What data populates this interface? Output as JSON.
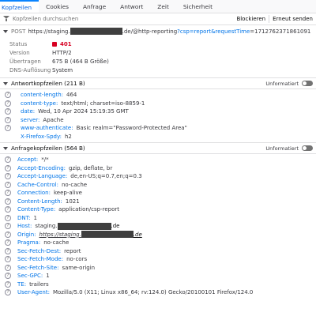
{
  "tabs": [
    {
      "label": "Kopfzeilen",
      "active": true
    },
    {
      "label": "Cookies"
    },
    {
      "label": "Anfrage"
    },
    {
      "label": "Antwort"
    },
    {
      "label": "Zeit"
    },
    {
      "label": "Sicherheit"
    }
  ],
  "filter": {
    "placeholder": "Kopfzeilen durchsuchen",
    "block_label": "Blockieren",
    "resend_label": "Erneut senden"
  },
  "request": {
    "method": "POST",
    "url_prefix": "https://staging.",
    "url_mid": ".de/@http-reporting",
    "url_path": "?csp=report",
    "url_query_key": "&requestTime",
    "url_query_val": "=1712762371861091"
  },
  "summary": [
    {
      "key": "Status",
      "value": "401",
      "status_color": "#d70022"
    },
    {
      "key": "Version",
      "value": "HTTP/2"
    },
    {
      "key": "Übertragen",
      "value": "675 B (464 B Größe)"
    },
    {
      "key": "DNS-Auflösung",
      "value": "System"
    }
  ],
  "response_section": {
    "title": "Antwortkopfzeilen (211 B)",
    "raw_label": "Unformatiert",
    "headers": [
      {
        "key": "content-length",
        "value": "464"
      },
      {
        "key": "content-type",
        "value": "text/html; charset=iso-8859-1"
      },
      {
        "key": "date",
        "value": "Wed, 10 Apr 2024 15:19:35 GMT"
      },
      {
        "key": "server",
        "value": "Apache"
      },
      {
        "key": "www-authenticate",
        "value": "Basic realm=\"Password-Protected Area\""
      },
      {
        "key": "X-Firefox-Spdy",
        "value": "h2"
      }
    ]
  },
  "request_section": {
    "title": "Anfragekopfzeilen (564 B)",
    "raw_label": "Unformatiert",
    "headers": [
      {
        "key": "Accept",
        "value": "*/*"
      },
      {
        "key": "Accept-Encoding",
        "value": "gzip, deflate, br"
      },
      {
        "key": "Accept-Language",
        "value": "de,en-US;q=0.7,en;q=0.3"
      },
      {
        "key": "Cache-Control",
        "value": "no-cache"
      },
      {
        "key": "Connection",
        "value": "keep-alive"
      },
      {
        "key": "Content-Length",
        "value": "1021"
      },
      {
        "key": "Content-Type",
        "value": "application/csp-report"
      },
      {
        "key": "DNT",
        "value": "1"
      },
      {
        "key": "Host",
        "value": "staging.",
        "suffix": ".de"
      },
      {
        "key": "Origin",
        "value": "https://staging.",
        "suffix": ".de"
      },
      {
        "key": "Pragma",
        "value": "no-cache"
      },
      {
        "key": "Sec-Fetch-Dest",
        "value": "report"
      },
      {
        "key": "Sec-Fetch-Mode",
        "value": "no-cors"
      },
      {
        "key": "Sec-Fetch-Site",
        "value": "same-origin"
      },
      {
        "key": "Sec-GPC",
        "value": "1"
      },
      {
        "key": "TE",
        "value": "trailers"
      },
      {
        "key": "User-Agent",
        "value": "Mozilla/5.0 (X11; Linux x86_64; rv:124.0) Gecko/20100101 Firefox/124.0"
      }
    ]
  },
  "help_glyph": "?"
}
